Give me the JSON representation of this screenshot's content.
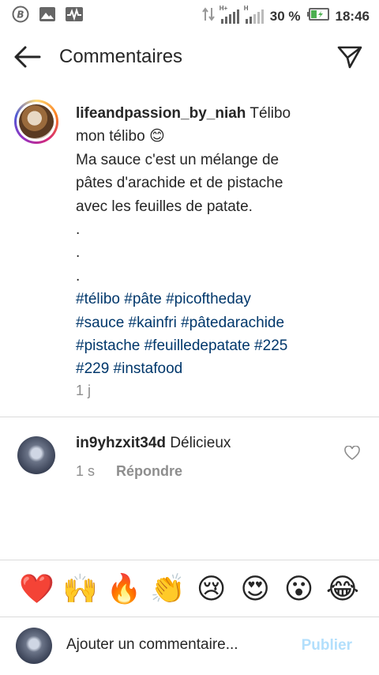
{
  "status_bar": {
    "icons_left": [
      "b-circle-icon",
      "image-icon",
      "activity-icon"
    ],
    "signal_labels": [
      "H+",
      "H"
    ],
    "battery_percent": "30 %",
    "time": "18:46",
    "colors": {
      "battery_fill": "#4caf50"
    }
  },
  "header": {
    "title": "Commentaires"
  },
  "caption": {
    "username": "lifeandpassion_by_niah",
    "lines": [
      " Télibo",
      "mon télibo 😊",
      "Ma sauce c'est un mélange de",
      "pâtes d'arachide et de pistache",
      "avec les feuilles de patate.",
      ".",
      ".",
      "."
    ],
    "hashtag_lines": [
      "#télibo #pâte #picoftheday",
      "#sauce #kainfri #pâtedarachide",
      "#pistache #feuilledepatate #225",
      "#229 #instafood"
    ],
    "time": "1 j"
  },
  "comments": [
    {
      "username": "in9yhzxit34d",
      "text": " Délicieux",
      "time": "1 s",
      "reply_label": "Répondre"
    }
  ],
  "emoji_bar": [
    "❤️",
    "🙌",
    "🔥",
    "👏",
    "😢",
    "😍",
    "😮",
    "😂"
  ],
  "input": {
    "placeholder": "Ajouter un commentaire...",
    "post_label": "Publier"
  },
  "colors": {
    "hashtag": "#00376b",
    "muted": "#8e8e8e",
    "post_disabled": "#b2dffc"
  }
}
